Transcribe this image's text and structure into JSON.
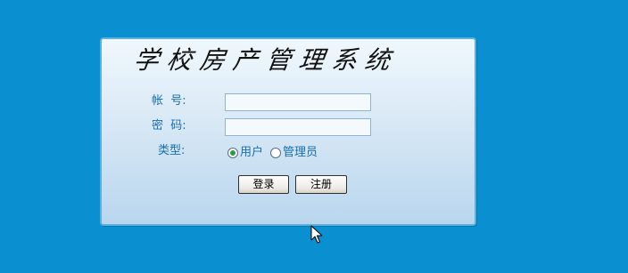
{
  "title": "学校房产管理系统",
  "form": {
    "account_label": "帐  号:",
    "account_value": "",
    "password_label": "密  码:",
    "password_value": "",
    "type_label": "类型:",
    "type_options": [
      {
        "label": "用户",
        "checked": true
      },
      {
        "label": "管理员",
        "checked": false
      }
    ]
  },
  "buttons": {
    "login": "登录",
    "register": "注册"
  },
  "colors": {
    "background": "#0a8fd0",
    "label": "#1a6fb0",
    "panel_border": "#5cb1dc"
  },
  "icons": {
    "cursor": "arrow-cursor-icon"
  }
}
